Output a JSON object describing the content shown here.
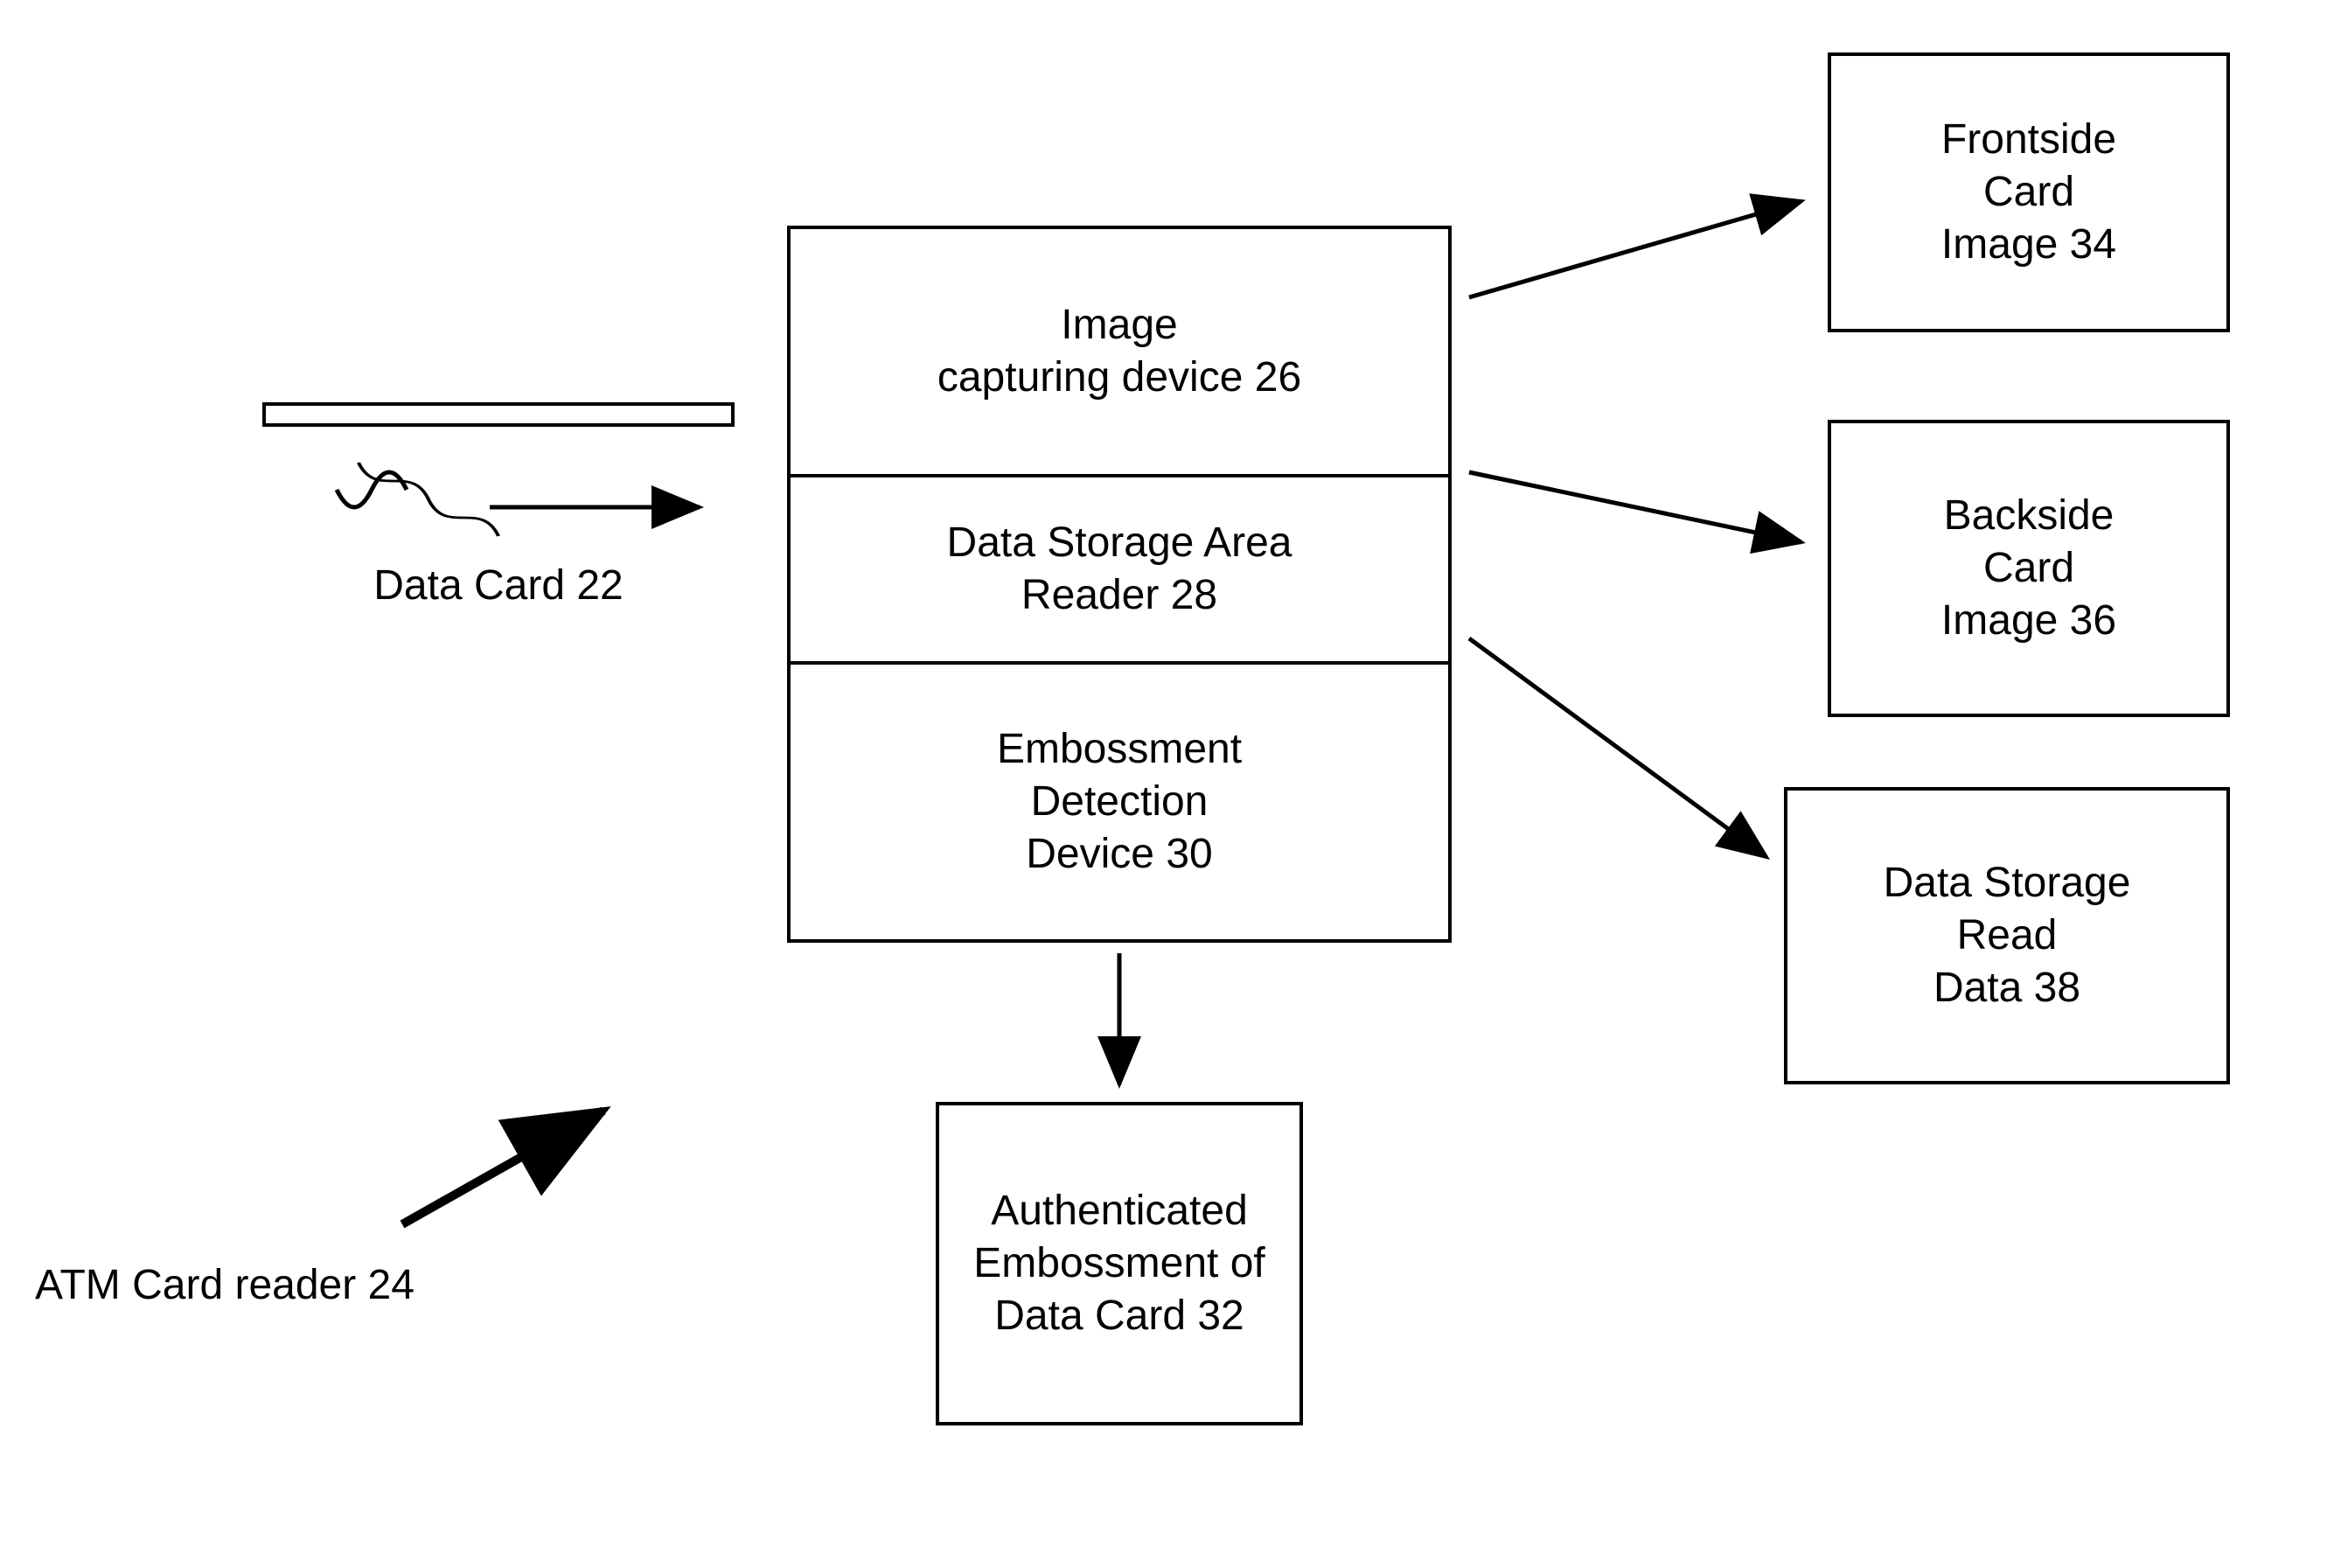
{
  "input": {
    "card_label": "Data Card 22",
    "reader_label": "ATM Card reader 24"
  },
  "center": {
    "image_capture": "Image\ncapturing device 26",
    "data_storage_reader": "Data Storage Area\nReader 28",
    "embossment_detection": "Embossment\nDetection\nDevice 30"
  },
  "bottom": {
    "authenticated": "Authenticated\nEmbossment of\nData Card 32"
  },
  "right": {
    "frontside": "Frontside\nCard\nImage 34",
    "backside": "Backside\nCard\nImage 36",
    "storage_read": "Data Storage\nRead\nData 38"
  }
}
